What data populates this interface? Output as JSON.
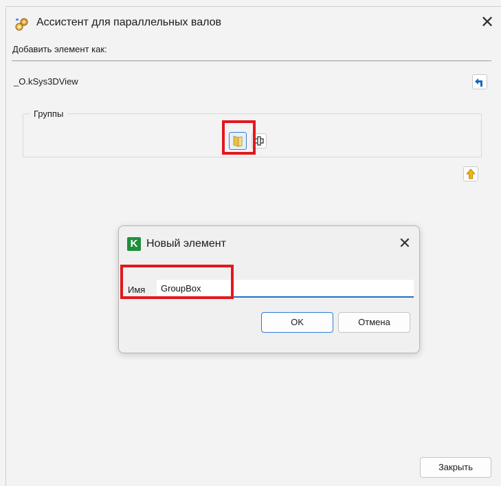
{
  "window": {
    "title": "Ассистент для параллельных валов",
    "close_icon": "close-icon"
  },
  "main": {
    "add_as_label": "Добавить элемент как:",
    "object_name": "_O.kSys3DView",
    "groupbox_label": "Группы"
  },
  "dialog": {
    "title": "Новый элемент",
    "field_label": "Имя",
    "field_value": "GroupBox",
    "ok_label": "OK",
    "cancel_label": "Отмена",
    "icon_letter": "K"
  },
  "footer": {
    "close_label": "Закрыть"
  },
  "colors": {
    "highlight": "#e2181e",
    "accent": "#1e6fd0",
    "dialog_icon": "#1f8f3a"
  }
}
